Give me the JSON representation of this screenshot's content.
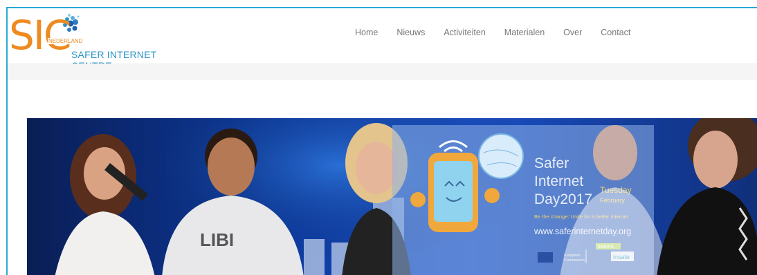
{
  "logo": {
    "mark": "SIC",
    "country": "NEDERLAND",
    "subtitle": "SAFER INTERNET CENTRE"
  },
  "nav": {
    "items": [
      {
        "label": "Home"
      },
      {
        "label": "Nieuws"
      },
      {
        "label": "Activiteiten"
      },
      {
        "label": "Materialen"
      },
      {
        "label": "Over"
      },
      {
        "label": "Contact"
      }
    ]
  },
  "hero": {
    "poster": {
      "line1": "Safer",
      "line2": "Internet",
      "line3": "Day2017",
      "date_day": "Tuesday",
      "date_month": "February",
      "tagline": "Be the change: Unite for a better internet",
      "url": "www.saferinternetday.org",
      "ec_label_1": "European",
      "ec_label_2": "Commission",
      "insafe_tag": "INHOPE",
      "insafe_label": "insafe"
    },
    "shirt_text": "LIBI"
  },
  "colors": {
    "accent": "#29a9d6",
    "brand_orange": "#ee8a1f",
    "brand_blue": "#2c93c6",
    "nav_text": "#777777"
  }
}
